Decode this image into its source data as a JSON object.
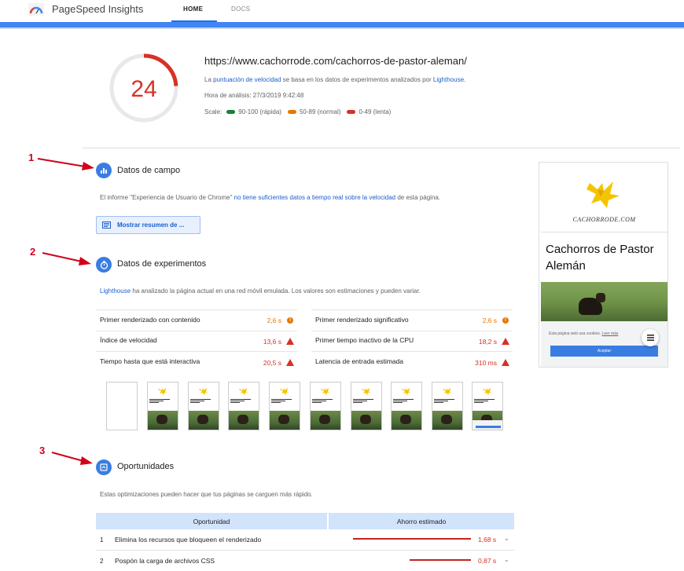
{
  "header": {
    "app_title": "PageSpeed Insights",
    "tabs": [
      {
        "label": "HOME",
        "active": true
      },
      {
        "label": "DOCS",
        "active": false
      }
    ]
  },
  "score": {
    "value": "24",
    "fraction": 0.24,
    "url": "https://www.cachorrode.com/cachorros-de-pastor-aleman/",
    "desc_prefix": "La ",
    "desc_link1": "puntuación de velocidad",
    "desc_mid": " se basa en los datos de experimentos analizados por ",
    "desc_link2": "Lighthouse",
    "desc_suffix": ".",
    "analysis_time": "Hora de análisis: 27/3/2019 9:42:48",
    "scale_label": "Scale:",
    "scale": [
      {
        "label": "90-100 (rápida)",
        "color": "#188038"
      },
      {
        "label": "50-89 (normal)",
        "color": "#e67700"
      },
      {
        "label": "0-49 (lenta)",
        "color": "#d93025"
      }
    ],
    "color": "#d93025"
  },
  "annotations": [
    "1",
    "2",
    "3"
  ],
  "field": {
    "title": "Datos de campo",
    "text_prefix": "El informe \"Experiencia de Usuario de Chrome\" ",
    "text_link": "no tiene suficientes datos a tiempo real sobre la velocidad",
    "text_suffix": " de esta página.",
    "button": "Mostrar resumen de ..."
  },
  "lab": {
    "title": "Datos de experimentos",
    "text_link": "Lighthouse",
    "text_rest": " ha analizado la página actual en una red móvil emulada. Los valores son estimaciones y pueden variar.",
    "metrics_left": [
      {
        "label": "Primer renderizado con contenido",
        "value": "2,6 s",
        "status": "average"
      },
      {
        "label": "Índice de velocidad",
        "value": "13,6 s",
        "status": "fail"
      },
      {
        "label": "Tiempo hasta que está interactiva",
        "value": "20,5 s",
        "status": "fail"
      }
    ],
    "metrics_right": [
      {
        "label": "Primer renderizado significativo",
        "value": "2,6 s",
        "status": "average"
      },
      {
        "label": "Primer tiempo inactivo de la CPU",
        "value": "18,2 s",
        "status": "fail"
      },
      {
        "label": "Latencia de entrada estimada",
        "value": "310 ms",
        "status": "fail"
      }
    ]
  },
  "preview": {
    "brand": "CACHORRODE.COM",
    "title_line1": "Cachorros de Pastor",
    "title_line2": "Alemán",
    "cookie_text": "Esta página web usa cookies.",
    "cookie_link": "Leer más",
    "accept": "Aceptar"
  },
  "opportunities": {
    "title": "Oportunidades",
    "text": "Estas optimizaciones pueden hacer que tus páginas se carguen más rápido.",
    "col1": "Oportunidad",
    "col2": "Ahorro estimado",
    "rows": [
      {
        "num": "1",
        "label": "Elimina los recursos que bloqueen el renderizado",
        "value": "1,68 s",
        "fraction": 1.0
      },
      {
        "num": "2",
        "label": "Pospón la carga de archivos CSS",
        "value": "0,87 s",
        "fraction": 0.52
      }
    ]
  }
}
